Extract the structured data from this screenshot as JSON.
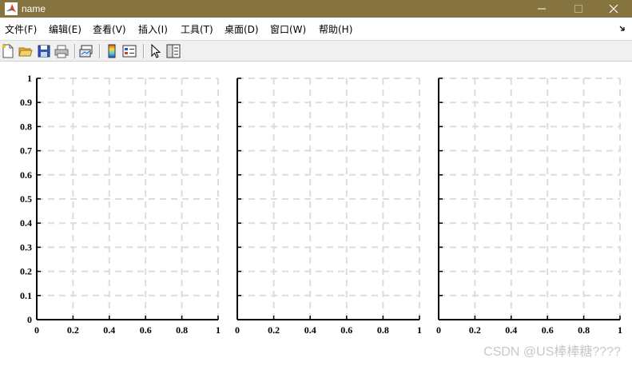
{
  "window": {
    "title": "name",
    "titlebar_color": "#857340",
    "app_icon": "matlab-logo-icon",
    "controls": [
      "minimize-icon",
      "maximize-icon",
      "close-icon"
    ]
  },
  "menu": {
    "items": [
      "文件(F)",
      "编辑(E)",
      "查看(V)",
      "插入(I)",
      "工具(T)",
      "桌面(D)",
      "窗口(W)",
      "帮助(H)"
    ],
    "overflow_icon": "dock-arrow-icon"
  },
  "toolbar": {
    "buttons": [
      "new-figure-icon",
      "open-file-icon",
      "save-icon",
      "print-icon",
      "link-plot-icon",
      "insert-colorbar-icon",
      "insert-legend-icon",
      "edit-plot-icon",
      "open-property-inspector-icon"
    ]
  },
  "chart_data": [
    {
      "type": "line",
      "series": [],
      "xlim": [
        0,
        1
      ],
      "ylim": [
        0,
        1
      ],
      "xticks": [
        "0",
        "0.2",
        "0.4",
        "0.6",
        "0.8",
        "1"
      ],
      "yticks": [
        "0",
        "0.1",
        "0.2",
        "0.3",
        "0.4",
        "0.5",
        "0.6",
        "0.7",
        "0.8",
        "0.9",
        "1"
      ],
      "grid": "dashed",
      "show_y_tick_labels": true
    },
    {
      "type": "line",
      "series": [],
      "xlim": [
        0,
        1
      ],
      "ylim": [
        0,
        1
      ],
      "xticks": [
        "0",
        "0.2",
        "0.4",
        "0.6",
        "0.8",
        "1"
      ],
      "yticks": [],
      "grid": "dashed",
      "show_y_tick_labels": false
    },
    {
      "type": "line",
      "series": [],
      "xlim": [
        0,
        1
      ],
      "ylim": [
        0,
        1
      ],
      "xticks": [
        "0",
        "0.2",
        "0.4",
        "0.6",
        "0.8",
        "1"
      ],
      "yticks": [],
      "grid": "dashed",
      "show_y_tick_labels": false
    }
  ],
  "watermark": "CSDN @US棒棒糖????"
}
